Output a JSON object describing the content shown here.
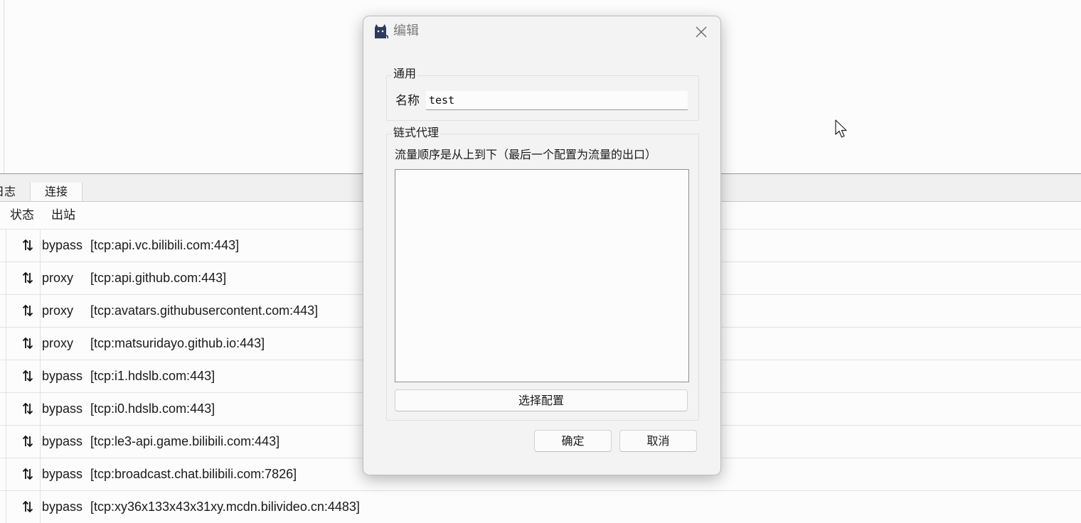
{
  "main": {
    "tabs": [
      "日志",
      "连接"
    ],
    "columns": {
      "status": "状态",
      "outbound": "出站"
    },
    "rows": [
      {
        "outbound": "bypass",
        "target": "[tcp:api.vc.bilibili.com:443]"
      },
      {
        "outbound": "proxy",
        "target": "[tcp:api.github.com:443]"
      },
      {
        "outbound": "proxy",
        "target": "[tcp:avatars.githubusercontent.com:443]"
      },
      {
        "outbound": "proxy",
        "target": "[tcp:matsuridayo.github.io:443]"
      },
      {
        "outbound": "bypass",
        "target": "[tcp:i1.hdslb.com:443]"
      },
      {
        "outbound": "bypass",
        "target": "[tcp:i0.hdslb.com:443]"
      },
      {
        "outbound": "bypass",
        "target": "[tcp:le3-api.game.bilibili.com:443]"
      },
      {
        "outbound": "bypass",
        "target": "[tcp:broadcast.chat.bilibili.com:7826]"
      },
      {
        "outbound": "bypass",
        "target": "[tcp:xy36x133x43x31xy.mcdn.bilivideo.cn:4483]"
      }
    ]
  },
  "dialog": {
    "title": "编辑",
    "general_group": "通用",
    "name_label": "名称",
    "name_value": "test",
    "chain_group": "链式代理",
    "chain_hint": "流量顺序是从上到下（最后一个配置为流量的出口）",
    "select_button": "选择配置",
    "ok_button": "确定",
    "cancel_button": "取消"
  },
  "colors": {
    "dialog_bg": "#f3f3f3",
    "window_bg": "#fcfcfc",
    "icon_dark": "#2f3a5c"
  },
  "icons": [
    "cat-app-icon",
    "close-icon",
    "updown-arrows-icon",
    "mouse-cursor-icon"
  ]
}
